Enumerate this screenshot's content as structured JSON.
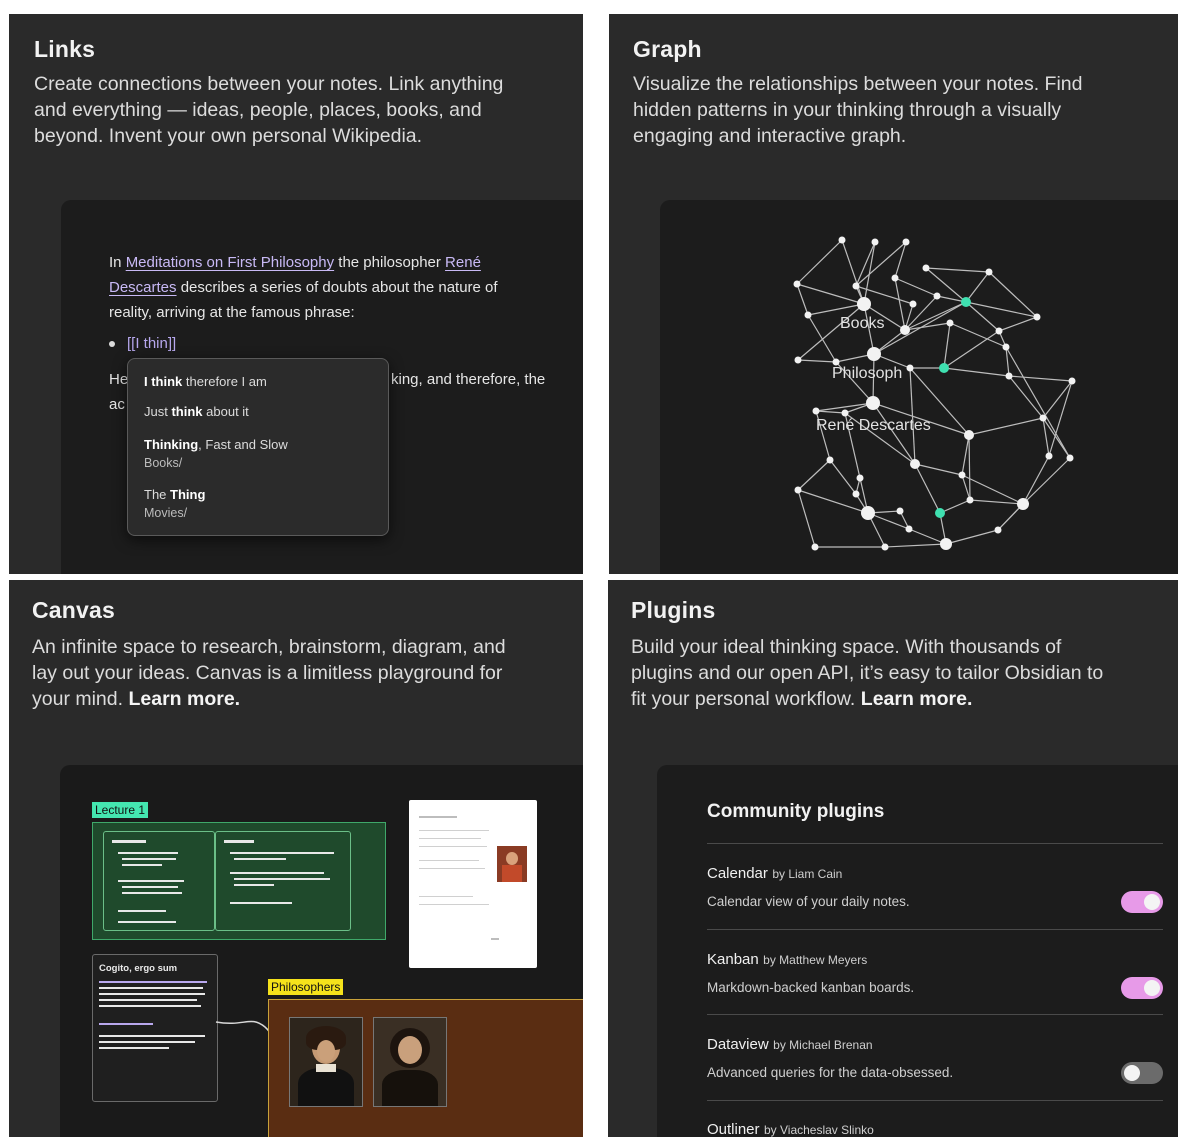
{
  "links": {
    "title": "Links",
    "desc_line1": "Create connections between your notes. Link anything",
    "desc_line2": "and everything — ideas, people, places, books, and",
    "desc_line3": "beyond. Invent your own personal Wikipedia.",
    "note": {
      "text_in": "In ",
      "link_meditations": "Meditations on First Philosophy",
      "text_philosopher": " the philosopher ",
      "link_rene": "René",
      "link_descartes": "Descartes",
      "text_rest1": " describes a series of doubts about the nature of",
      "text_rest2": "reality, arriving at the famous phrase:",
      "bullet": "[[I thin]]",
      "partial_left_1": "He",
      "partial_left_2": "ac",
      "partial_right": "king, and therefore, the"
    },
    "suggestions": [
      {
        "bold": "I think",
        "rest": " therefore I am",
        "path": ""
      },
      {
        "pre": "Just ",
        "bold": "think",
        "rest": " about it",
        "path": ""
      },
      {
        "bold": "Thinking",
        "rest": ", Fast and Slow",
        "path": "Books/"
      },
      {
        "pre": "The ",
        "bold": "Thing",
        "rest": "",
        "path": "Movies/"
      }
    ]
  },
  "graph": {
    "title": "Graph",
    "desc_line1": "Visualize the relationships between your notes. Find",
    "desc_line2": "hidden patterns in your thinking through a visually",
    "desc_line3": "engaging and interactive graph.",
    "labels": [
      "Books",
      "Philosoph",
      "René Descartes"
    ],
    "colors": {
      "node": "#f2f2f2",
      "edge": "#bdbdbd",
      "accent": "#3fe0b0"
    }
  },
  "canvas": {
    "title": "Canvas",
    "desc_line1": "An infinite space to research, brainstorm, diagram, and",
    "desc_line2": "lay out your ideas. Canvas is a limitless playground for",
    "desc_line3": "your mind.",
    "learn_more": "Learn more.",
    "lecture_label": "Lecture 1",
    "philosophers_label": "Philosophers",
    "note_title": "Cogito, ergo sum",
    "colors": {
      "lecture": "#44e6b0",
      "philosophers": "#f5e21b",
      "green_card": "#1f4a2c",
      "orange_card": "#5a2d12"
    }
  },
  "plugins": {
    "title": "Plugins",
    "desc_line1": "Build your ideal thinking space. With thousands of",
    "desc_line2": "plugins and our open API, it’s easy to tailor Obsidian to",
    "desc_line3": "fit your personal workflow.",
    "learn_more": "Learn more.",
    "list_title": "Community plugins",
    "items": [
      {
        "name": "Calendar",
        "by": "by Liam Cain",
        "desc": "Calendar view of your daily notes.",
        "enabled": true
      },
      {
        "name": "Kanban",
        "by": "by Matthew Meyers",
        "desc": "Markdown-backed kanban boards.",
        "enabled": true
      },
      {
        "name": "Dataview",
        "by": "by Michael Brenan",
        "desc": "Advanced queries for the data-obsessed.",
        "enabled": false
      },
      {
        "name": "Outliner",
        "by": "by Viacheslav Slinko",
        "desc": "",
        "enabled": false
      }
    ],
    "colors": {
      "toggle_on": "#e79ae8",
      "toggle_off": "#6b6b6b"
    }
  }
}
